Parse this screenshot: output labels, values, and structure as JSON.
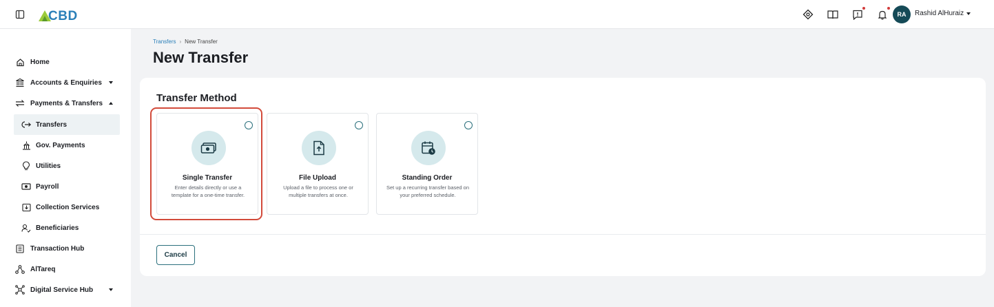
{
  "header": {
    "logo_text": "CBD",
    "user": {
      "initials": "RA",
      "name": "Rashid AlHuraiz"
    },
    "icons": [
      "tag-icon",
      "book-icon",
      "feedback-icon",
      "bell-icon"
    ]
  },
  "sidebar": {
    "items": [
      {
        "label": "Home",
        "icon": "home-icon"
      },
      {
        "label": "Accounts & Enquiries",
        "icon": "bank-icon"
      },
      {
        "label": "Payments & Transfers",
        "icon": "transfer-icon"
      },
      {
        "label": "Transfers",
        "icon": "transfers-icon"
      },
      {
        "label": "Gov. Payments",
        "icon": "government-icon"
      },
      {
        "label": "Utilities",
        "icon": "bulb-icon"
      },
      {
        "label": "Payroll",
        "icon": "payroll-icon"
      },
      {
        "label": "Collection Services",
        "icon": "collection-icon"
      },
      {
        "label": "Beneficiaries",
        "icon": "beneficiaries-icon"
      },
      {
        "label": "Transaction Hub",
        "icon": "transaction-hub-icon"
      },
      {
        "label": "AlTareq",
        "icon": "network-icon"
      },
      {
        "label": "Digital Service Hub",
        "icon": "digital-hub-icon"
      }
    ]
  },
  "breadcrumb": {
    "parent": "Transfers",
    "separator": "›",
    "current": "New Transfer"
  },
  "page": {
    "title": "New Transfer"
  },
  "transfer_method": {
    "title": "Transfer Method",
    "options": [
      {
        "title": "Single Transfer",
        "description": "Enter details directly or use a template for a one-time transfer."
      },
      {
        "title": "File Upload",
        "description": "Upload a file to process one or multiple transfers at once."
      },
      {
        "title": "Standing Order",
        "description": "Set up a recurring transfer based on your preferred schedule."
      }
    ]
  },
  "actions": {
    "cancel_label": "Cancel"
  },
  "colors": {
    "brand": "#2a7fb8",
    "accent": "#2a6f7c",
    "highlight": "#d24a3a",
    "avatar_bg": "#154a57"
  }
}
